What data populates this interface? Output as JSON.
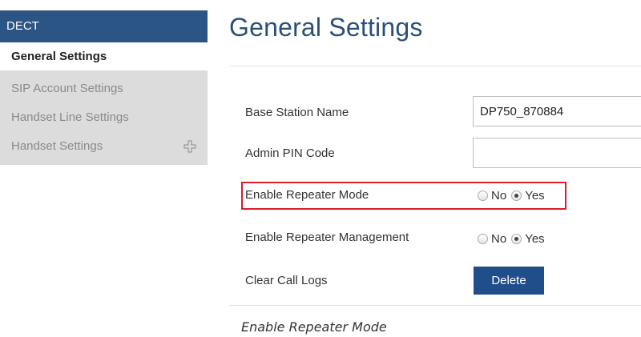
{
  "sidebar": {
    "header": "DECT",
    "active_item": "General Settings",
    "items": [
      {
        "label": "SIP Account Settings",
        "icon": null
      },
      {
        "label": "Handset Line Settings",
        "icon": null
      },
      {
        "label": "Handset Settings",
        "icon": "expand-plus-icon"
      }
    ]
  },
  "main": {
    "title": "General Settings",
    "fields": {
      "base_station_name": {
        "label": "Base Station Name",
        "value": "DP750_870884"
      },
      "admin_pin": {
        "label": "Admin PIN Code",
        "value": ""
      },
      "repeater_mode": {
        "label": "Enable Repeater Mode",
        "options": [
          "No",
          "Yes"
        ],
        "selected": "Yes"
      },
      "repeater_management": {
        "label": "Enable Repeater Management",
        "options": [
          "No",
          "Yes"
        ],
        "selected": "Yes"
      },
      "clear_call_logs": {
        "label": "Clear Call Logs",
        "button": "Delete"
      }
    }
  },
  "caption": "Enable Repeater Mode",
  "colors": {
    "accent": "#2a5584",
    "highlight": "#d81e2a",
    "button": "#1f4e8a"
  }
}
